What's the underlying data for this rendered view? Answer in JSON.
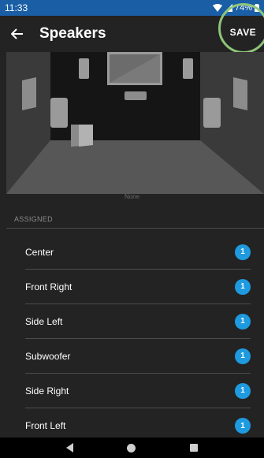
{
  "status_bar": {
    "time": "11:33",
    "battery": "74%"
  },
  "app_bar": {
    "title": "Speakers",
    "save_label": "SAVE"
  },
  "room": {
    "caption": "None"
  },
  "assigned": {
    "section_label": "ASSIGNED",
    "speakers": [
      {
        "name": "Center",
        "count": "1"
      },
      {
        "name": "Front Right",
        "count": "1"
      },
      {
        "name": "Side Left",
        "count": "1"
      },
      {
        "name": "Subwoofer",
        "count": "1"
      },
      {
        "name": "Side Right",
        "count": "1"
      },
      {
        "name": "Front Left",
        "count": "1"
      }
    ]
  },
  "colors": {
    "accent": "#1e9ae0",
    "status_bar": "#1a5fa6",
    "background": "#232323",
    "highlight_ring": "#8fc57b"
  },
  "icons": [
    "back-arrow-icon",
    "wifi-icon",
    "signal-icon",
    "battery-icon",
    "nav-back-icon",
    "nav-home-icon",
    "nav-recents-icon"
  ]
}
